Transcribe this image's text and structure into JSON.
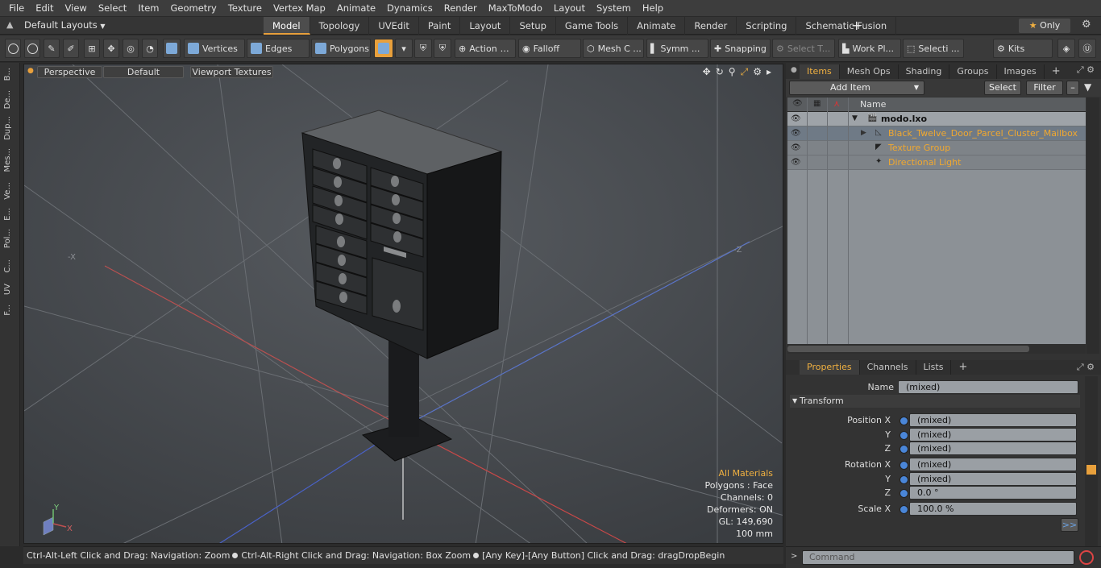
{
  "menu": [
    "File",
    "Edit",
    "View",
    "Select",
    "Item",
    "Geometry",
    "Texture",
    "Vertex Map",
    "Animate",
    "Dynamics",
    "Render",
    "MaxToModo",
    "Layout",
    "System",
    "Help"
  ],
  "layout_selector": "Default Layouts",
  "mode_tabs": [
    "Model",
    "Topology",
    "UVEdit",
    "Paint",
    "Layout",
    "Setup",
    "Game Tools",
    "Animate",
    "Render",
    "Scripting",
    "Schematic Fusion"
  ],
  "active_mode_tab": "Model",
  "only_label": "Only",
  "toolbar": {
    "vertices": "Vertices",
    "edges": "Edges",
    "polygons": "Polygons",
    "action": "Action",
    "falloff": "Falloff",
    "mesh": "Mesh C ...",
    "symm": "Symm ...",
    "snapping": "Snapping",
    "select_t": "Select T...",
    "work_pl": "Work Pl...",
    "selecti": "Selecti ...",
    "kits": "Kits"
  },
  "left_strip": [
    "B...",
    "De...",
    "Dup...",
    "Mes...",
    "Ve...",
    "E...",
    "Pol...",
    "C...",
    "UV",
    "F..."
  ],
  "viewport": {
    "view_mode": "Perspective",
    "shading": "Default",
    "textures": "Viewport Textures",
    "axis_neg_x": "-X",
    "axis_neg_z": "-Z",
    "info": {
      "all_materials": "All Materials",
      "polygons": "Polygons : Face",
      "channels": "Channels: 0",
      "deformers": "Deformers: ON",
      "gl": "GL: 149,690",
      "size": "100 mm"
    }
  },
  "status": {
    "part1": "Ctrl-Alt-Left Click and Drag: Navigation: Zoom",
    "part2": "Ctrl-Alt-Right Click and Drag: Navigation: Box Zoom",
    "part3": "[Any Key]-[Any Button] Click and Drag: dragDropBegin"
  },
  "items_panel": {
    "tabs": [
      "Items",
      "Mesh Ops",
      "Shading",
      "Groups",
      "Images"
    ],
    "active_tab": "Items",
    "add_item": "Add Item",
    "select": "Select",
    "filter": "Filter",
    "column_name": "Name",
    "rows": [
      {
        "label": "modo.lxo"
      },
      {
        "label": "Black_Twelve_Door_Parcel_Cluster_Mailbox"
      },
      {
        "label": "Texture Group"
      },
      {
        "label": "Directional Light"
      }
    ]
  },
  "properties_panel": {
    "tabs": [
      "Properties",
      "Channels",
      "Lists"
    ],
    "active_tab": "Properties",
    "name_label": "Name",
    "name_value": "(mixed)",
    "section": "Transform",
    "fields": [
      {
        "label": "Position X",
        "value": "(mixed)"
      },
      {
        "label": "Y",
        "value": "(mixed)"
      },
      {
        "label": "Z",
        "value": "(mixed)"
      },
      {
        "label": "Rotation X",
        "value": "(mixed)"
      },
      {
        "label": "Y",
        "value": "(mixed)"
      },
      {
        "label": "Z",
        "value": "0.0 °"
      },
      {
        "label": "Scale X",
        "value": "100.0 %"
      }
    ],
    "more": ">>"
  },
  "command_placeholder": "Command",
  "colors": {
    "accent": "#f0b040",
    "selection_blue": "#4a86d8"
  }
}
